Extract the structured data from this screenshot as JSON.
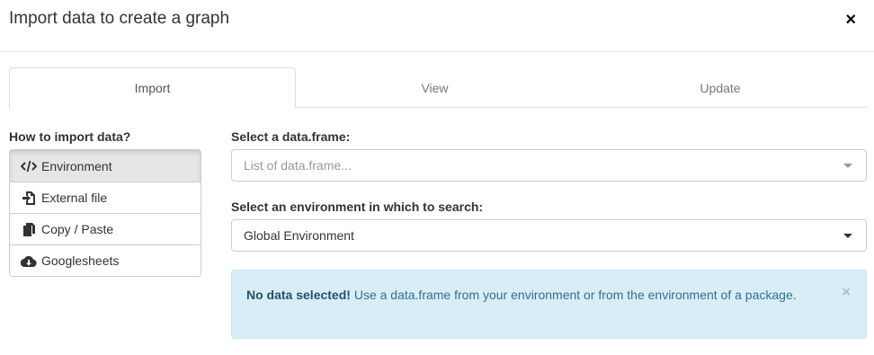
{
  "modal": {
    "title": "Import data to create a graph",
    "close_symbol": "×"
  },
  "tabs": [
    {
      "label": "Import",
      "active": true
    },
    {
      "label": "View",
      "active": false
    },
    {
      "label": "Update",
      "active": false
    }
  ],
  "import_methods": {
    "heading": "How to import data?",
    "items": [
      {
        "label": "Environment",
        "icon": "code-icon",
        "active": true
      },
      {
        "label": "External file",
        "icon": "file-import-icon",
        "active": false
      },
      {
        "label": "Copy / Paste",
        "icon": "copy-icon",
        "active": false
      },
      {
        "label": "Googlesheets",
        "icon": "cloud-download-icon",
        "active": false
      }
    ]
  },
  "dataframe_select": {
    "label": "Select a data.frame:",
    "placeholder": "List of data.frame..."
  },
  "environment_select": {
    "label": "Select an environment in which to search:",
    "value": "Global Environment"
  },
  "alert": {
    "title": "No data selected!",
    "message": " Use a data.frame from your environment or from the environment of a package.",
    "close_symbol": "×"
  },
  "colors": {
    "alert_bg": "#d9edf7",
    "alert_border": "#bce8f1",
    "alert_text": "#31708f",
    "active_item_bg": "#e6e6e6"
  }
}
